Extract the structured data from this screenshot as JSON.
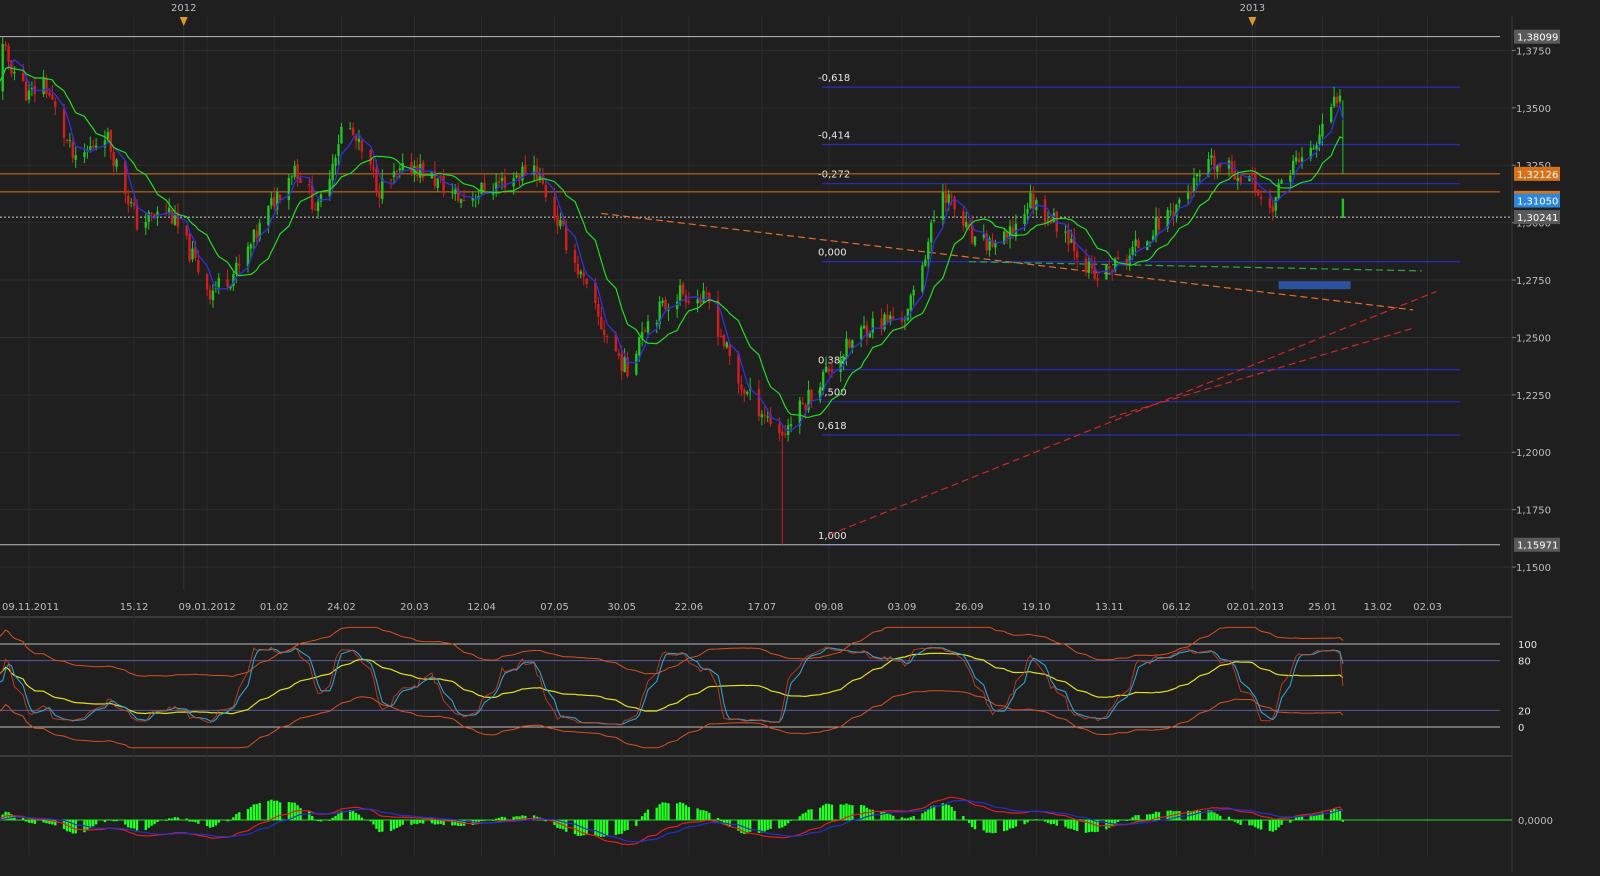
{
  "chart_data": [
    {
      "type": "candlestick",
      "panel": "price",
      "year_markers": [
        "2012",
        "2013"
      ],
      "x_tick_labels": [
        "09.11.2011",
        "15.12",
        "09.01.2012",
        "01.02",
        "24.02",
        "20.03",
        "12.04",
        "07.05",
        "30.05",
        "22.06",
        "17.07",
        "09.08",
        "03.09",
        "26.09",
        "19.10",
        "13.11",
        "06.12",
        "02.01.2013",
        "25.01",
        "13.02",
        "02.03"
      ],
      "y_tick_labels": [
        "1,3750",
        "1,3500",
        "1,3250",
        "1,3000",
        "1,2750",
        "1,2500",
        "1,2250",
        "1,2000",
        "1,1750",
        "1,1500"
      ],
      "ylim": [
        1.14,
        1.39
      ],
      "price_tags": [
        {
          "value": 1.38099,
          "label": "1,38099",
          "color": "#5a5a5a"
        },
        {
          "value": 1.32126,
          "label": "1,32126",
          "color": "#d9701a"
        },
        {
          "value": 1.31341,
          "label": "1,31341",
          "color": "#d9701a"
        },
        {
          "value": 1.3105,
          "label": "1,31050",
          "color": "#2d86d6"
        },
        {
          "value": 1.30241,
          "label": "1,30241",
          "color": "#5a5a5a"
        },
        {
          "value": 1.15971,
          "label": "1,15971",
          "color": "#5a5a5a"
        }
      ],
      "fibonacci": [
        {
          "label": "-0,618",
          "value": 1.359
        },
        {
          "label": "-0,414",
          "value": 1.334
        },
        {
          "label": "-0,272",
          "value": 1.317
        },
        {
          "label": "0,000",
          "value": 1.283
        },
        {
          "label": "0,382",
          "value": 1.236
        },
        {
          "label": "0,500",
          "value": 1.222
        },
        {
          "label": "0,618",
          "value": 1.2075
        },
        {
          "label": "1,000",
          "value": 1.1597
        }
      ],
      "anchors": [
        {
          "date": "2011-10-27",
          "close": 1.355
        },
        {
          "date": "2011-10-31",
          "close": 1.375
        },
        {
          "date": "2011-11-09",
          "close": 1.355
        },
        {
          "date": "2011-11-14",
          "close": 1.362
        },
        {
          "date": "2011-11-25",
          "close": 1.325
        },
        {
          "date": "2011-12-05",
          "close": 1.34
        },
        {
          "date": "2011-12-16",
          "close": 1.3
        },
        {
          "date": "2011-12-27",
          "close": 1.305
        },
        {
          "date": "2012-01-10",
          "close": 1.27
        },
        {
          "date": "2012-01-20",
          "close": 1.28
        },
        {
          "date": "2012-02-01",
          "close": 1.31
        },
        {
          "date": "2012-02-08",
          "close": 1.325
        },
        {
          "date": "2012-02-16",
          "close": 1.305
        },
        {
          "date": "2012-02-25",
          "close": 1.345
        },
        {
          "date": "2012-03-08",
          "close": 1.315
        },
        {
          "date": "2012-03-20",
          "close": 1.325
        },
        {
          "date": "2012-04-05",
          "close": 1.31
        },
        {
          "date": "2012-04-23",
          "close": 1.32
        },
        {
          "date": "2012-04-30",
          "close": 1.325
        },
        {
          "date": "2012-05-10",
          "close": 1.295
        },
        {
          "date": "2012-05-23",
          "close": 1.255
        },
        {
          "date": "2012-06-01",
          "close": 1.235
        },
        {
          "date": "2012-06-06",
          "close": 1.255
        },
        {
          "date": "2012-06-19",
          "close": 1.27
        },
        {
          "date": "2012-06-29",
          "close": 1.265
        },
        {
          "date": "2012-07-09",
          "close": 1.23
        },
        {
          "date": "2012-07-24",
          "close": 1.208
        },
        {
          "date": "2012-08-08",
          "close": 1.235
        },
        {
          "date": "2012-08-22",
          "close": 1.255
        },
        {
          "date": "2012-09-05",
          "close": 1.26
        },
        {
          "date": "2012-09-17",
          "close": 1.315
        },
        {
          "date": "2012-09-28",
          "close": 1.29
        },
        {
          "date": "2012-10-09",
          "close": 1.292
        },
        {
          "date": "2012-10-17",
          "close": 1.31
        },
        {
          "date": "2012-10-30",
          "close": 1.295
        },
        {
          "date": "2012-11-08",
          "close": 1.275
        },
        {
          "date": "2012-11-19",
          "close": 1.285
        },
        {
          "date": "2012-12-04",
          "close": 1.305
        },
        {
          "date": "2012-12-18",
          "close": 1.325
        },
        {
          "date": "2012-12-31",
          "close": 1.32
        },
        {
          "date": "2013-01-07",
          "close": 1.305
        },
        {
          "date": "2013-01-14",
          "close": 1.325
        },
        {
          "date": "2013-01-21",
          "close": 1.33
        },
        {
          "date": "2013-01-25",
          "close": 1.34
        },
        {
          "date": "2013-01-30",
          "close": 1.355
        },
        {
          "date": "2013-02-01",
          "close": 1.362
        }
      ]
    },
    {
      "type": "line",
      "panel": "stochastic",
      "ylim": [
        0,
        100
      ],
      "levels": [
        {
          "value": 100,
          "label": "100"
        },
        {
          "value": 80,
          "label": "80"
        },
        {
          "value": 20,
          "label": "20"
        },
        {
          "value": 0,
          "label": "0"
        }
      ]
    },
    {
      "type": "bar",
      "panel": "macd",
      "zero_label": "0,0000"
    }
  ]
}
